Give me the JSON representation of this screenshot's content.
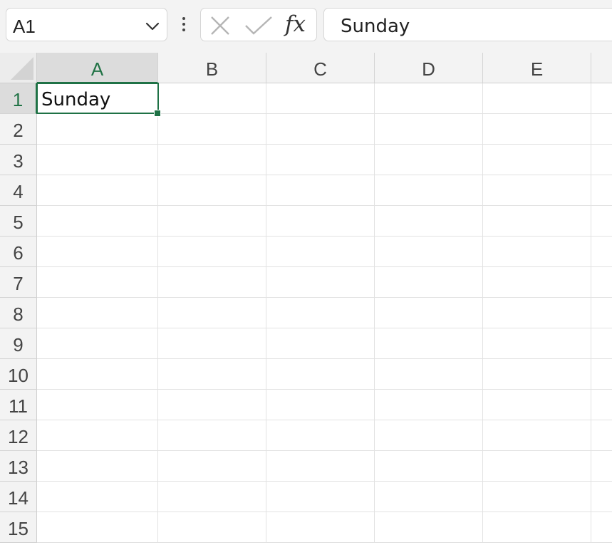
{
  "name_box": {
    "value": "A1"
  },
  "formula_bar": {
    "cancel_icon": "x-icon",
    "enter_icon": "check-icon",
    "fx_label": "fx",
    "value": "Sunday"
  },
  "columns": [
    "A",
    "B",
    "C",
    "D",
    "E"
  ],
  "rows": [
    "1",
    "2",
    "3",
    "4",
    "5",
    "6",
    "7",
    "8",
    "9",
    "10",
    "11",
    "12",
    "13",
    "14",
    "15"
  ],
  "cells": {
    "A1": "Sunday"
  },
  "selected_cell": "A1",
  "colors": {
    "accent": "#217346",
    "header_bg": "#f3f3f3",
    "gridline": "#e2e2e2"
  }
}
